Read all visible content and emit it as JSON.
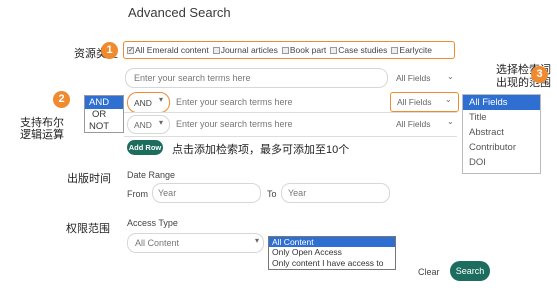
{
  "title": "Advanced Search",
  "annotations": {
    "resource_type": "资源类型",
    "boolean_ops": "支持布尔\n逻辑运算",
    "fields_note": "选择检索词\n出现的范围",
    "add_row_note": "点击添加检索项，最多可添加至10个",
    "publish_time": "出版时间",
    "access_scope": "权限范围",
    "badges": [
      "1",
      "2",
      "3"
    ]
  },
  "resource_types": [
    {
      "label": "All Emerald content",
      "checked": true
    },
    {
      "label": "Journal articles",
      "checked": false
    },
    {
      "label": "Book part",
      "checked": false
    },
    {
      "label": "Case studies",
      "checked": false
    },
    {
      "label": "Earlycite",
      "checked": false
    }
  ],
  "search_rows": [
    {
      "operator": "",
      "placeholder": "Enter your search terms here",
      "field": "All Fields"
    },
    {
      "operator": "AND",
      "placeholder": "Enter your search terms here",
      "field": "All Fields"
    },
    {
      "operator": "AND",
      "placeholder": "Enter your search terms here",
      "field": "All Fields"
    }
  ],
  "operator_menu": {
    "items": [
      "AND",
      "OR",
      "NOT"
    ],
    "selected": "AND"
  },
  "field_menu": {
    "items": [
      "All Fields",
      "Title",
      "Abstract",
      "Contributor",
      "DOI"
    ],
    "selected": "All Fields"
  },
  "add_row_label": "Add Row",
  "date_range": {
    "label": "Date Range",
    "from_label": "From",
    "from_placeholder": "Year",
    "to_label": "To",
    "to_placeholder": "Year"
  },
  "access_type": {
    "label": "Access Type",
    "value": "All Content",
    "options": [
      "All Content",
      "Only Open Access",
      "Only content I have access to"
    ],
    "selected": "All Content"
  },
  "clear_label": "Clear",
  "search_label": "Search"
}
